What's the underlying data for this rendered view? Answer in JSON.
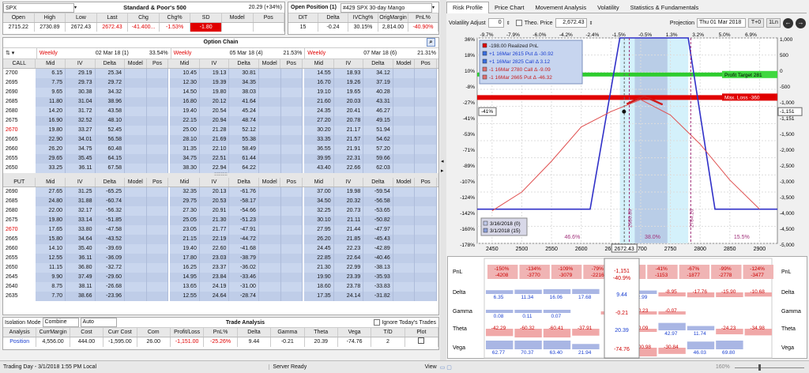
{
  "top": {
    "symbol": "SPX",
    "index_title": "Standard & Poor's 500",
    "index_change": "20.29 (+34%)",
    "index_headers": [
      "Open",
      "High",
      "Low",
      "Last",
      "Chg",
      "Chg%",
      "SD",
      "Model",
      "Pos"
    ],
    "index_values": [
      "2715.22",
      "2730.89",
      "2672.43",
      "2672.43",
      "-41.400...",
      "-1.53%",
      "-1.80",
      "",
      ""
    ],
    "open_pos_title": "Open Position (1)",
    "position_name": "#429 SPX 30-day Mango",
    "pos_headers": [
      "DIT",
      "Delta",
      "IVChg%",
      "OrigMargin",
      "PnL%"
    ],
    "pos_values": [
      "15",
      "-0.24",
      "30.15%",
      "2,814.00",
      "-40.90%"
    ]
  },
  "chain": {
    "title": "Option Chain",
    "call_label": "CALL",
    "put_label": "PUT",
    "expiries": [
      {
        "type": "Weekly",
        "date": "02 Mar 18 (1)",
        "pct": "33.54%"
      },
      {
        "type": "Weekly",
        "date": "05 Mar 18 (4)",
        "pct": "21.53%"
      },
      {
        "type": "Weekly",
        "date": "07 Mar 18 (6)",
        "pct": "21.31%"
      }
    ],
    "cols": [
      "Mid",
      "IV",
      "Delta",
      "Model",
      "Pos"
    ],
    "calls": [
      [
        "2700",
        "6.15",
        "29.19",
        "25.34",
        "10.45",
        "19.13",
        "30.81",
        "14.55",
        "18.93",
        "34.12"
      ],
      [
        "2695",
        "7.75",
        "29.73",
        "29.72",
        "12.30",
        "19.39",
        "34.35",
        "16.70",
        "19.26",
        "37.19"
      ],
      [
        "2690",
        "9.65",
        "30.38",
        "34.32",
        "14.50",
        "19.80",
        "38.03",
        "19.10",
        "19.65",
        "40.28"
      ],
      [
        "2685",
        "11.80",
        "31.04",
        "38.96",
        "16.80",
        "20.12",
        "41.64",
        "21.60",
        "20.03",
        "43.31"
      ],
      [
        "2680",
        "14.20",
        "31.72",
        "43.58",
        "19.40",
        "20.54",
        "45.24",
        "24.35",
        "20.41",
        "46.27"
      ],
      [
        "2675",
        "16.90",
        "32.52",
        "48.10",
        "22.15",
        "20.94",
        "48.74",
        "27.20",
        "20.78",
        "49.15"
      ],
      [
        "2670",
        "19.80",
        "33.27",
        "52.45",
        "25.00",
        "21.28",
        "52.12",
        "30.20",
        "21.17",
        "51.94"
      ],
      [
        "2665",
        "22.90",
        "34.01",
        "56.58",
        "28.10",
        "21.69",
        "55.38",
        "33.35",
        "21.57",
        "54.62"
      ],
      [
        "2660",
        "26.20",
        "34.75",
        "60.48",
        "31.35",
        "22.10",
        "58.49",
        "36.55",
        "21.91",
        "57.20"
      ],
      [
        "2655",
        "29.65",
        "35.45",
        "64.15",
        "34.75",
        "22.51",
        "61.44",
        "39.95",
        "22.31",
        "59.66"
      ],
      [
        "2650",
        "33.25",
        "36.11",
        "67.58",
        "38.30",
        "22.94",
        "64.22",
        "43.40",
        "22.66",
        "62.03"
      ]
    ],
    "puts": [
      [
        "2690",
        "27.65",
        "31.25",
        "-65.25",
        "32.35",
        "20.13",
        "-61.76",
        "37.00",
        "19.98",
        "-59.54"
      ],
      [
        "2685",
        "24.80",
        "31.88",
        "-60.74",
        "29.75",
        "20.53",
        "-58.17",
        "34.50",
        "20.32",
        "-56.58"
      ],
      [
        "2680",
        "22.00",
        "32.17",
        "-56.32",
        "27.30",
        "20.91",
        "-54.66",
        "32.25",
        "20.73",
        "-53.65"
      ],
      [
        "2675",
        "19.80",
        "33.14",
        "-51.85",
        "25.05",
        "21.30",
        "-51.23",
        "30.10",
        "21.11",
        "-50.82"
      ],
      [
        "2670",
        "17.65",
        "33.80",
        "-47.58",
        "23.05",
        "21.77",
        "-47.91",
        "27.95",
        "21.44",
        "-47.97"
      ],
      [
        "2665",
        "15.80",
        "34.64",
        "-43.52",
        "21.15",
        "22.19",
        "-44.72",
        "26.20",
        "21.85",
        "-45.43"
      ],
      [
        "2660",
        "14.10",
        "35.40",
        "-39.69",
        "19.40",
        "22.60",
        "-41.68",
        "24.45",
        "22.23",
        "-42.89"
      ],
      [
        "2655",
        "12.55",
        "36.11",
        "-36.09",
        "17.80",
        "23.03",
        "-38.79",
        "22.85",
        "22.64",
        "-40.46"
      ],
      [
        "2650",
        "11.15",
        "36.80",
        "-32.72",
        "16.25",
        "23.37",
        "-36.02",
        "21.30",
        "22.99",
        "-38.13"
      ],
      [
        "2645",
        "9.90",
        "37.49",
        "-29.60",
        "14.95",
        "23.84",
        "-33.46",
        "19.90",
        "23.39",
        "-35.93"
      ],
      [
        "2640",
        "8.75",
        "38.11",
        "-26.68",
        "13.65",
        "24.19",
        "-31.00",
        "18.60",
        "23.78",
        "-33.83"
      ],
      [
        "2635",
        "7.70",
        "38.66",
        "-23.96",
        "12.55",
        "24.64",
        "-28.74",
        "17.35",
        "24.14",
        "-31.82"
      ]
    ]
  },
  "trade": {
    "isolation_label": "Isolation Mode",
    "mode1": "Combine",
    "mode2": "Auto",
    "title": "Trade Analysis",
    "ignore_label": "Ignore Today's Trades",
    "headers": [
      "Analysis",
      "CurrMargin",
      "Cost",
      "Curr Cost",
      "Com",
      "Profit/Loss",
      "PnL%",
      "Delta",
      "Gamma",
      "Theta",
      "Vega",
      "T/D",
      "Plot"
    ],
    "values": [
      "Position",
      "4,556.00",
      "444.00",
      "-1,595.00",
      "26.00",
      "-1,151.00",
      "-25.26%",
      "9.44",
      "-0.21",
      "20.39",
      "-74.76",
      "2",
      ""
    ]
  },
  "status": {
    "left": "Trading Day - 3/1/2018 1:55 PM Local",
    "mid": "Server Ready",
    "view": "View",
    "zoom": "160%"
  },
  "right": {
    "tabs": [
      "Risk Profile",
      "Price Chart",
      "Movement Analysis",
      "Volatility",
      "Statistics & Fundamentals"
    ],
    "vol_label": "Volatility Adjust",
    "vol_val": "0",
    "theo_label": "Theo. Price",
    "theo_val": "2,672.43",
    "proj_label": "Projection",
    "proj_val": "Thu 01 Mar 2018",
    "btn_t0": "T+0",
    "btn_1ln": "1Ln"
  },
  "chart_data": {
    "type": "line",
    "x_ticks": [
      "2450",
      "2500",
      "2550",
      "2600",
      "2650",
      "2700",
      "2750",
      "2800",
      "2850",
      "2900"
    ],
    "top_pct_ticks": [
      "-9.7%",
      "-7.9%",
      "-6.0%",
      "-4.2%",
      "-2.4%",
      "-1.5%",
      "-0.5%",
      "1.3%",
      "3.2%",
      "5.0%",
      "6.9%"
    ],
    "left_ticks": [
      "36%",
      "18%",
      "10%",
      "-8%",
      "-27%",
      "-41%",
      "-53%",
      "-71%",
      "-89%",
      "-107%",
      "-124%",
      "-142%",
      "-160%",
      "-178%"
    ],
    "right_ticks": [
      "1,000",
      "500",
      "0",
      "-500",
      "-1,000",
      "-1,151",
      "-1,500",
      "-2,000",
      "-2,500",
      "-3,000",
      "-3,500",
      "-4,000",
      "-4,500",
      "-5,000"
    ],
    "legend": [
      "-198.00 Realized PnL",
      "+1 16Mar 2615 Put Δ  -30.92",
      "+1 16Mar 2825 Call Δ  3.12",
      "-1 16Mar 2780 Call Δ  -9.09",
      "-1 16Mar 2665 Put Δ  -46.32"
    ],
    "profit_target": "Profit Target 281",
    "max_loss": "Max. Loss -360",
    "left_badge": "-41%",
    "right_badge": "-1,151",
    "current": "2672.43",
    "vlines": [
      "2680.89",
      "2784.26"
    ],
    "regions": [
      "46.6%",
      "38.0%",
      "15.5%"
    ],
    "dates": [
      "3/16/2018 (0)",
      "3/1/2018 (15)"
    ],
    "expiry_payoff": {
      "x": [
        2400,
        2615,
        2665,
        2780,
        2825,
        2950
      ],
      "pnl": [
        -4000,
        -4000,
        1000,
        1000,
        -4000,
        -4000
      ]
    },
    "t0_curve": {
      "x": [
        2450,
        2500,
        2550,
        2600,
        2650,
        2700,
        2750,
        2800,
        2850,
        2900
      ],
      "pnl": [
        -4050,
        -3500,
        -2600,
        -1600,
        -1150,
        -800,
        -1250,
        -2100,
        -3150,
        -4000
      ]
    }
  },
  "greeks": {
    "rows": [
      "PnL",
      "Delta",
      "Gamma",
      "Theta",
      "Vega"
    ],
    "pnl": [
      "-150%",
      "-134%",
      "-109%",
      "-79%",
      "-58%",
      "-41%",
      "-67%",
      "-99%",
      "-124%"
    ],
    "pnl_b": [
      "-4208",
      "-3770",
      "-3079",
      "-2216",
      "-1153",
      "-1877",
      "-2778",
      "-3477"
    ],
    "delta": [
      "6.35",
      "11.34",
      "16.06",
      "17.68",
      "",
      "2.99",
      "-8.95",
      "-17.76",
      "-15.90",
      "-10.68"
    ],
    "gamma": [
      "0.08",
      "0.11",
      "0.07",
      "",
      "-0.02",
      "-0.23",
      "-0.07"
    ],
    "theta": [
      "-42.29",
      "-60.32",
      "-60.41",
      "-37.91",
      "",
      "-0.09",
      "42.97",
      "11.74",
      "-24.23",
      "-34.98"
    ],
    "vega": [
      "62.77",
      "70.37",
      "63.40",
      "21.94",
      "",
      "-100.98",
      "-30.84",
      "46.03",
      "69.80"
    ],
    "center": {
      "pnl": "-1,151",
      "pnl_pct": "-40.9%",
      "delta": "9.44",
      "gamma": "-0.21",
      "theta": "20.39",
      "vega": "-74.76"
    }
  }
}
